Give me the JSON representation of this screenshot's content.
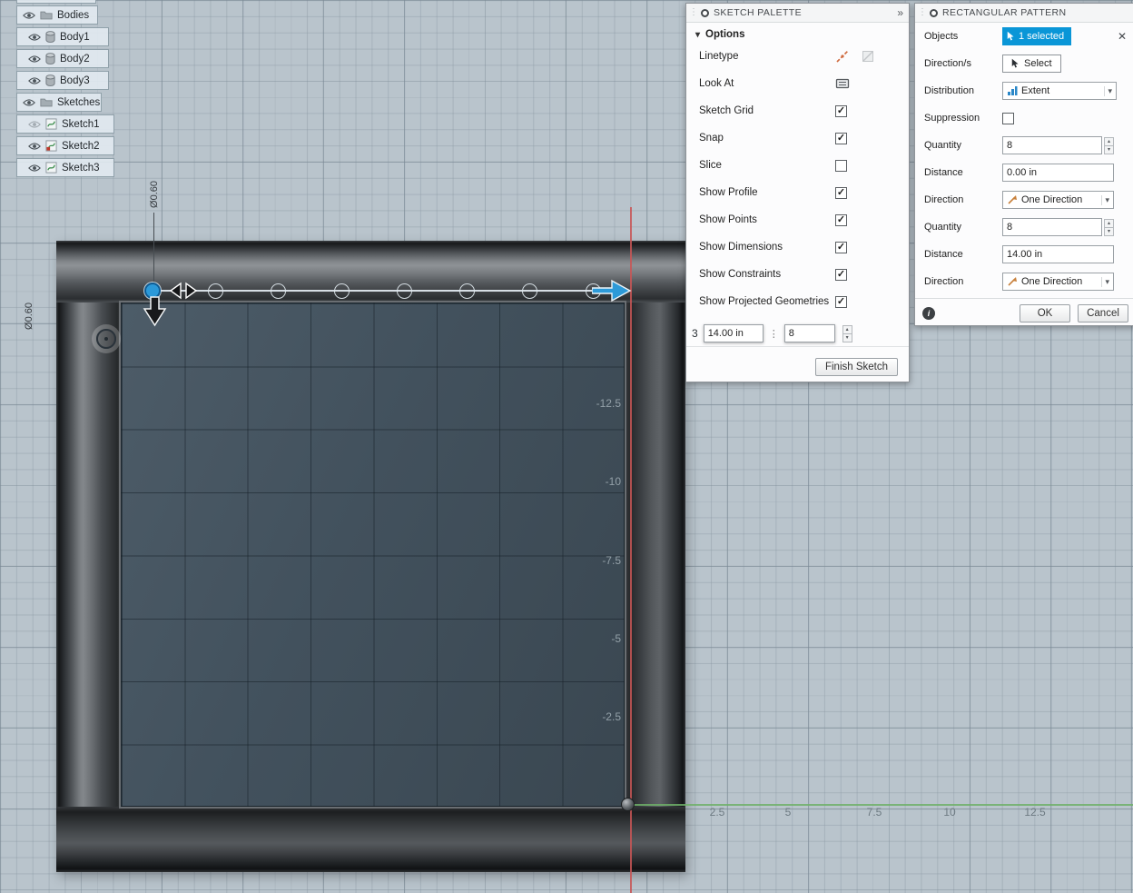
{
  "browser": {
    "rows": [
      {
        "label": "Bodies",
        "type": "folder",
        "eye": "visible"
      },
      {
        "label": "Body1",
        "type": "body",
        "eye": "visible"
      },
      {
        "label": "Body2",
        "type": "body",
        "eye": "visible"
      },
      {
        "label": "Body3",
        "type": "body",
        "eye": "visible"
      },
      {
        "label": "Sketches",
        "type": "folder",
        "eye": "visible"
      },
      {
        "label": "Sketch1",
        "type": "sketch",
        "eye": "hidden"
      },
      {
        "label": "Sketch2",
        "type": "sketch",
        "eye": "visible"
      },
      {
        "label": "Sketch3",
        "type": "sketch",
        "eye": "visible"
      }
    ]
  },
  "sketch_palette": {
    "title": "SKETCH PALETTE",
    "options_label": "Options",
    "rows": [
      {
        "label": "Linetype"
      },
      {
        "label": "Look At"
      },
      {
        "label": "Sketch Grid",
        "check": "✓"
      },
      {
        "label": "Snap",
        "check": "✓"
      },
      {
        "label": "Slice",
        "check": ""
      },
      {
        "label": "Show Profile",
        "check": "✓"
      },
      {
        "label": "Show Points",
        "check": "✓"
      },
      {
        "label": "Show Dimensions",
        "check": "✓"
      },
      {
        "label": "Show Constraints",
        "check": "✓"
      },
      {
        "label": "Show Projected Geometries",
        "check": "✓"
      }
    ],
    "finish_label": "Finish Sketch"
  },
  "rectangular_pattern": {
    "title": "RECTANGULAR PATTERN",
    "rows": [
      {
        "label": "Objects",
        "value": "1 selected"
      },
      {
        "label": "Direction/s",
        "button": "Select"
      },
      {
        "label": "Distribution",
        "value": "Extent"
      },
      {
        "label": "Suppression"
      },
      {
        "label": "Quantity",
        "value": "8"
      },
      {
        "label": "Distance",
        "value": "0.00 in"
      },
      {
        "label": "Direction",
        "value": "One Direction"
      },
      {
        "label": "Quantity",
        "value": "8"
      },
      {
        "label": "Distance",
        "value": "14.00 in"
      },
      {
        "label": "Direction",
        "value": "One Direction"
      }
    ],
    "ok": "OK",
    "cancel": "Cancel"
  },
  "canvas_inputs": {
    "prefix": "3",
    "distance": "14.00 in",
    "count": "8"
  },
  "dimensions": {
    "top": "Ø0.60",
    "left": "Ø0.60"
  },
  "axes": {
    "y_labels": [
      "-12.5",
      "-10",
      "-7.5",
      "-5",
      "-2.5"
    ],
    "x_labels": [
      "2.5",
      "5",
      "7.5",
      "10",
      "12.5"
    ]
  },
  "icons": {
    "panel_collapse": "»",
    "options_triangle": "▾",
    "chevron_down": "▾",
    "close": "✕",
    "spinner_up": "▴",
    "spinner_down": "▾",
    "grip": "⋮",
    "info": "i"
  },
  "colors": {
    "canvas_bg": "#b9c4cc",
    "x_axis_green": "#6eb069",
    "y_axis_red": "#c95656",
    "selection_blue": "#0a96d7"
  }
}
